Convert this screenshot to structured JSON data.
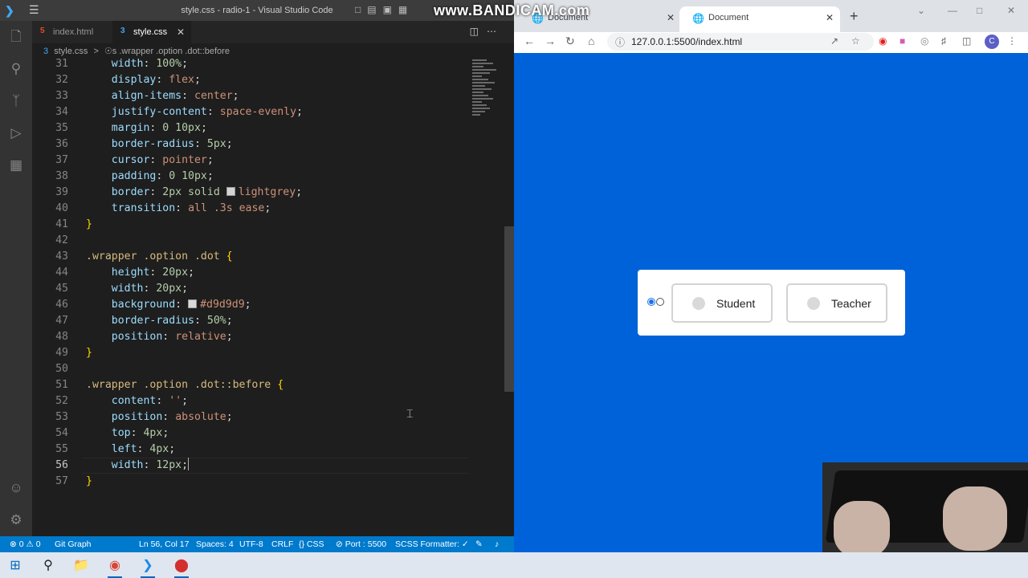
{
  "vscode": {
    "window_title": "style.css - radio-1 - Visual Studio Code",
    "tabs": [
      {
        "label": "index.html",
        "active": false
      },
      {
        "label": "style.css",
        "active": true
      }
    ],
    "breadcrumb": [
      "style.css",
      ">",
      "☉s .wrapper .option .dot::before"
    ],
    "icons": [
      "explorer-icon",
      "search-icon",
      "source-control-icon",
      "run-debug-icon",
      "extensions-icon",
      "account-icon",
      "settings-gear-icon"
    ],
    "lines": [
      {
        "n": "31"
      },
      {
        "n": "32"
      },
      {
        "n": "33"
      },
      {
        "n": "34"
      },
      {
        "n": "35"
      },
      {
        "n": "36"
      },
      {
        "n": "37"
      },
      {
        "n": "38"
      },
      {
        "n": "39"
      },
      {
        "n": "40"
      },
      {
        "n": "41"
      },
      {
        "n": "42"
      },
      {
        "n": "43"
      },
      {
        "n": "44"
      },
      {
        "n": "45"
      },
      {
        "n": "46"
      },
      {
        "n": "47"
      },
      {
        "n": "48"
      },
      {
        "n": "49"
      },
      {
        "n": "50"
      },
      {
        "n": "51"
      },
      {
        "n": "52"
      },
      {
        "n": "53"
      },
      {
        "n": "54"
      },
      {
        "n": "55"
      },
      {
        "n": "56"
      },
      {
        "n": "57"
      }
    ],
    "code": {
      "l31": [
        "width",
        ": ",
        "100%",
        ";"
      ],
      "l32": [
        "display",
        ": ",
        "flex",
        ";"
      ],
      "l33": [
        "align-items",
        ": ",
        "center",
        ";"
      ],
      "l34": [
        "justify-content",
        ": ",
        "space-evenly",
        ";"
      ],
      "l35": [
        "margin",
        ": ",
        "0 10px",
        ";"
      ],
      "l36": [
        "border-radius",
        ": ",
        "5px",
        ";"
      ],
      "l37": [
        "cursor",
        ": ",
        "pointer",
        ";"
      ],
      "l38": [
        "padding",
        ": ",
        "0 10px",
        ";"
      ],
      "l39": [
        "border",
        ": ",
        "2px solid",
        "lightgrey",
        ";"
      ],
      "l40": [
        "transition",
        ": ",
        "all .3s ease",
        ";"
      ],
      "l41": "}",
      "l43": [
        ".wrapper .option .dot",
        " {"
      ],
      "l44": [
        "height",
        ": ",
        "20px",
        ";"
      ],
      "l45": [
        "width",
        ": ",
        "20px",
        ";"
      ],
      "l46": [
        "background",
        ": ",
        "#d9d9d9",
        ";"
      ],
      "l47": [
        "border-radius",
        ": ",
        "50%",
        ";"
      ],
      "l48": [
        "position",
        ": ",
        "relative",
        ";"
      ],
      "l49": "}",
      "l51": [
        ".wrapper .option .dot::before",
        " {"
      ],
      "l52": [
        "content",
        ": ",
        "''",
        ";"
      ],
      "l53": [
        "position",
        ": ",
        "absolute",
        ";"
      ],
      "l54": [
        "top",
        ": ",
        "4px",
        ";"
      ],
      "l55": [
        "left",
        ": ",
        "4px",
        ";"
      ],
      "l56": [
        "width",
        ": ",
        "12px",
        ";"
      ],
      "l57": "}"
    },
    "status": {
      "errors": "⊗ 0 ⚠ 0",
      "git": "Git Graph",
      "position": "Ln 56, Col 17",
      "spaces": "Spaces: 4",
      "encoding": "UTF-8",
      "eol": "CRLF",
      "language": "{} CSS",
      "port": "⊘ Port : 5500",
      "formatter": "SCSS Formatter: ✓"
    }
  },
  "overlay": {
    "watermark": "www.BANDICAM.com"
  },
  "browser": {
    "tabs": [
      {
        "label": "Document",
        "active": false
      },
      {
        "label": "Document",
        "active": true
      }
    ],
    "url": "127.0.0.1:5500/index.html",
    "page": {
      "options": [
        {
          "label": "Student",
          "selected": false
        },
        {
          "label": "Teacher",
          "selected": false
        }
      ],
      "native_radios": [
        {
          "checked": true
        },
        {
          "checked": false
        }
      ],
      "background": "#0062d9"
    }
  },
  "taskbar": {
    "items": [
      "windows-start-icon",
      "search-icon",
      "file-explorer-icon",
      "chrome-icon",
      "vscode-icon",
      "bandicam-record-icon"
    ]
  },
  "colors": {
    "statusbar": "#007acc",
    "accent": "#1a73e8"
  }
}
